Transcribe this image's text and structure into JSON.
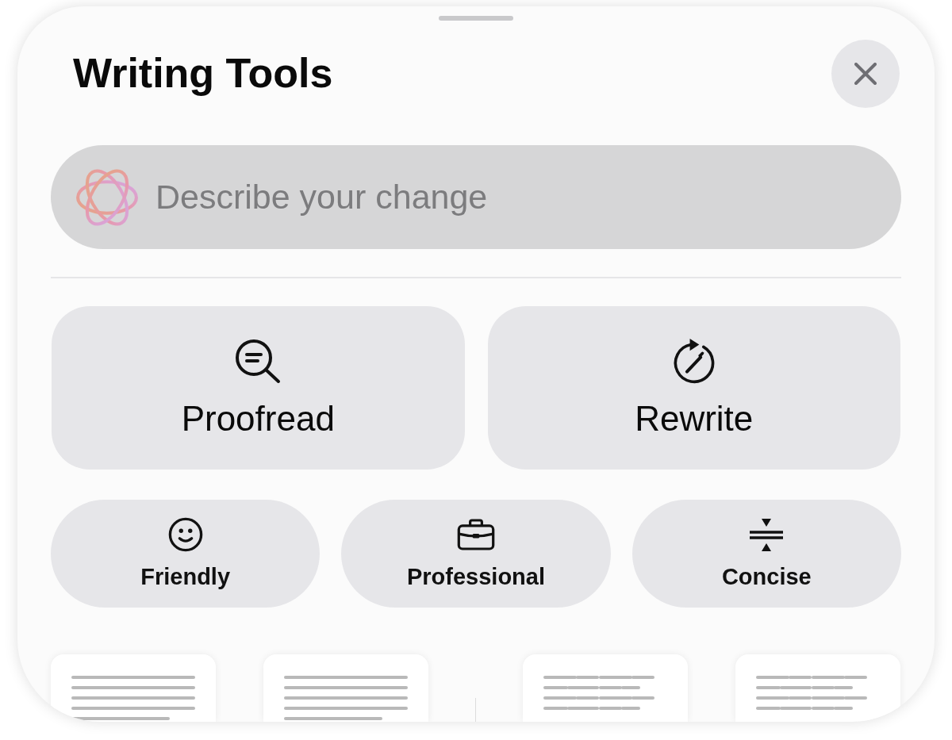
{
  "sheet": {
    "title": "Writing Tools"
  },
  "prompt": {
    "placeholder": "Describe your change"
  },
  "main_actions": [
    {
      "label": "Proofread"
    },
    {
      "label": "Rewrite"
    }
  ],
  "tone_actions": [
    {
      "label": "Friendly"
    },
    {
      "label": "Professional"
    },
    {
      "label": "Concise"
    }
  ],
  "previews": [
    {
      "kind": "text"
    },
    {
      "kind": "text"
    },
    {
      "kind": "table"
    },
    {
      "kind": "table"
    }
  ]
}
